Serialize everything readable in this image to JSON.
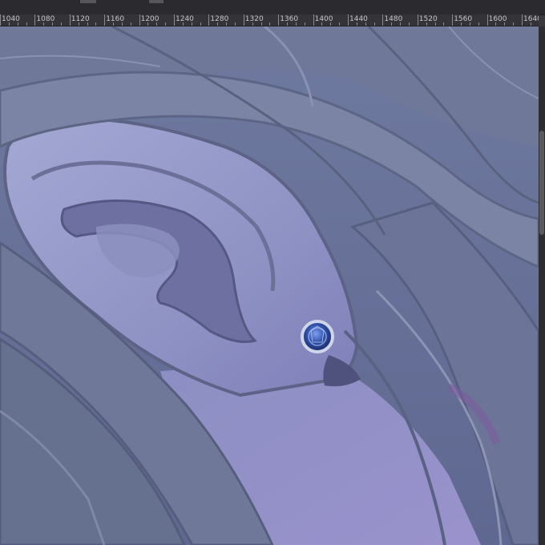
{
  "ruler": {
    "unit": "px",
    "labels": [
      "1040",
      "1080",
      "1120",
      "1160",
      "1200",
      "1240",
      "1280",
      "1320",
      "1360",
      "1400",
      "1440",
      "1480",
      "1520",
      "1560",
      "1600",
      "1640"
    ]
  },
  "canvas": {
    "subject": "illustration of an ear with a blue gem earring among strands of hair"
  },
  "colors": {
    "skin": "#8f93c4",
    "hair": "#6c7597",
    "earring_gem": "#2f4fa6",
    "earring_setting": "#cfd6ea"
  }
}
